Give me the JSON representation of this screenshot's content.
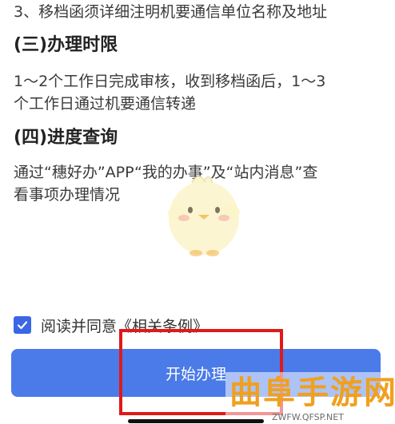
{
  "content": {
    "line_3": "3、移档函须详细注明机要通信单位名称及地址",
    "section_3_title": "(三)办理时限",
    "section_3_body_1": "1～2个工作日完成审核，收到移档函后，1～3",
    "section_3_body_2": "个工作日通过机要通信转递",
    "section_4_title": "(四)进度查询",
    "section_4_body_1": "通过“穗好办”APP“我的办事”及“站内消息”查",
    "section_4_body_2": "看事项办理情况"
  },
  "consent": {
    "checked": true,
    "prefix": "阅读并同意",
    "link": "《相关条例》"
  },
  "actions": {
    "start_label": "开始办理"
  },
  "watermark": {
    "title": "曲阜手游网",
    "url": "ZWFW.QFSP.NET"
  },
  "colors": {
    "primary": "#4a7be8",
    "checkbox": "#3b66e6",
    "highlight": "#e01919",
    "watermark": "#f0a01e"
  },
  "icons": {
    "mascot": "chick-mascot-icon",
    "checkbox": "check-icon"
  }
}
